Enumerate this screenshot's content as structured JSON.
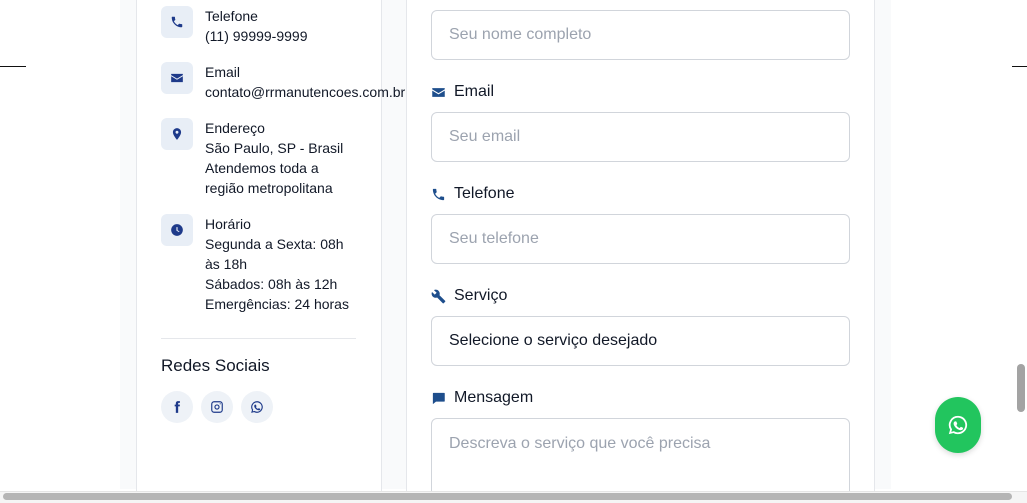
{
  "contact_info": {
    "phone": {
      "label": "Telefone",
      "value": "(11) 99999-9999"
    },
    "email": {
      "label": "Email",
      "value": "contato@rrmanutencoes.com.br"
    },
    "address": {
      "label": "Endereço",
      "line1": "São Paulo, SP - Brasil",
      "line2": "Atendemos toda a",
      "line3": "região metropolitana"
    },
    "hours": {
      "label": "Horário",
      "line1": "Segunda a Sexta: 08h",
      "line2": "às 18h",
      "line3": "Sábados: 08h às 12h",
      "line4": "Emergências: 24 horas"
    }
  },
  "social": {
    "title": "Redes Sociais",
    "icons": [
      "facebook-icon",
      "instagram-icon",
      "whatsapp-icon"
    ]
  },
  "form": {
    "name_placeholder": "Seu nome completo",
    "email_label": "Email",
    "email_placeholder": "Seu email",
    "phone_label": "Telefone",
    "phone_placeholder": "Seu telefone",
    "service_label": "Serviço",
    "service_selected": "Selecione o serviço desejado",
    "message_label": "Mensagem",
    "message_placeholder": "Descreva o serviço que você precisa"
  },
  "colors": {
    "accent": "#1e3a8a",
    "whatsapp": "#22c55e"
  }
}
